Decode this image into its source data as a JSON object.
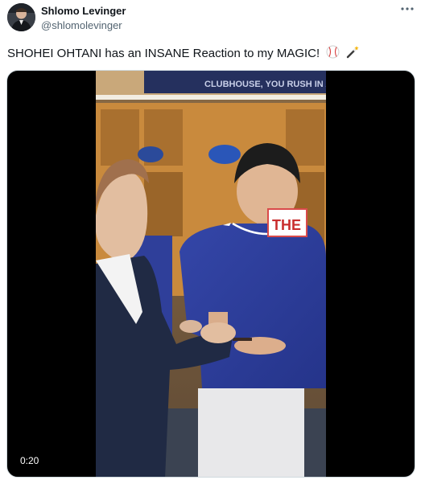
{
  "tweet": {
    "author_name": "Shlomo Levinger",
    "author_handle": "@shlomolevinger",
    "text": "SHOHEI OHTANI has an INSANE Reaction to my MAGIC!",
    "emojis": [
      "baseball-icon",
      "magic-wand-icon"
    ],
    "more_icon": "more-horizontal-icon"
  },
  "video": {
    "duration": "0:20",
    "scene_sign_text": "CLUBHOUSE, YOU RUSH IN AN",
    "jersey_tag_text": "THE"
  },
  "colors": {
    "text_primary": "#0f1419",
    "text_secondary": "#536471",
    "jersey_blue": "#2f3f9a",
    "locker_wood": "#c98a3d"
  }
}
